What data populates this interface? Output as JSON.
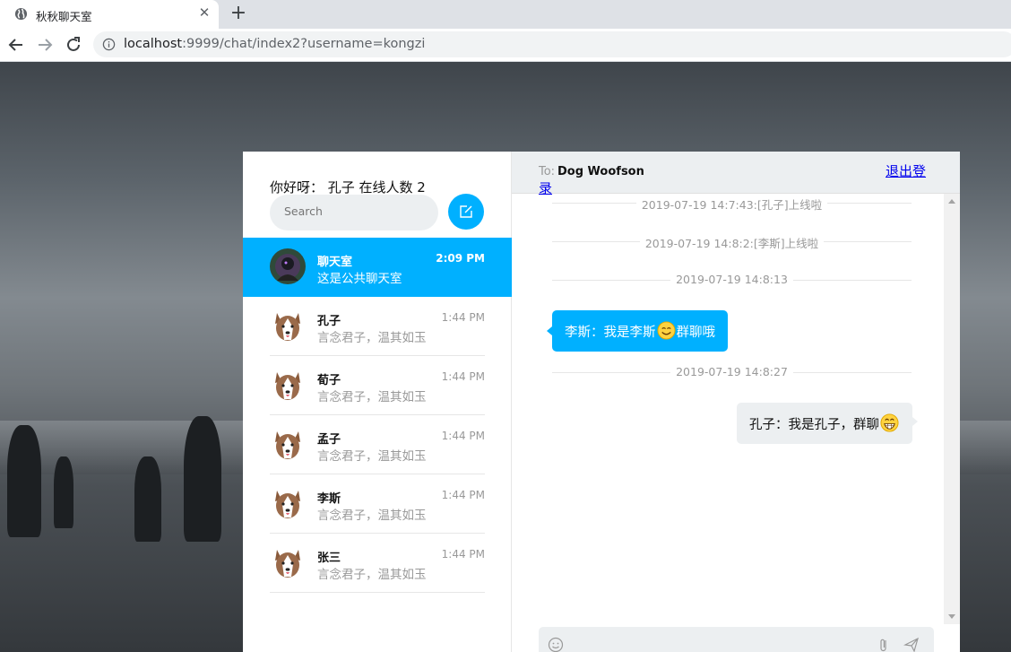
{
  "browser": {
    "tab_title": "秋秋聊天室",
    "url_host": "localhost",
    "url_rest": ":9999/chat/index2?username=kongzi"
  },
  "sidebar": {
    "greeting": "你好呀：  孔子   在线人数 2",
    "search_placeholder": "Search",
    "contacts": [
      {
        "name": "聊天室",
        "time": "2:09 PM",
        "preview": "这是公共聊天室",
        "active": true
      },
      {
        "name": "孔子",
        "time": "1:44 PM",
        "preview": "言念君子，温其如玉"
      },
      {
        "name": "荀子",
        "time": "1:44 PM",
        "preview": "言念君子，温其如玉"
      },
      {
        "name": "孟子",
        "time": "1:44 PM",
        "preview": "言念君子，温其如玉"
      },
      {
        "name": "李斯",
        "time": "1:44 PM",
        "preview": "言念君子，温其如玉"
      },
      {
        "name": "张三",
        "time": "1:44 PM",
        "preview": "言念君子，温其如玉"
      }
    ]
  },
  "chat": {
    "to_label": "To:",
    "to_name": "Dog Woofson",
    "logout_main": "退出登",
    "logout_spill": "录",
    "dividers": [
      "2019-07-19 14:7:43:[孔子]上线啦",
      "2019-07-19 14:8:2:[李斯]上线啦",
      "2019-07-19 14:8:13",
      "2019-07-19 14:8:27"
    ],
    "message_you_before": "李斯：我是李斯",
    "message_you_after": "群聊哦",
    "message_me": "孔子：我是孔子，群聊"
  },
  "colors": {
    "accent": "#00b0ff",
    "panel_gray": "#eceff1"
  }
}
